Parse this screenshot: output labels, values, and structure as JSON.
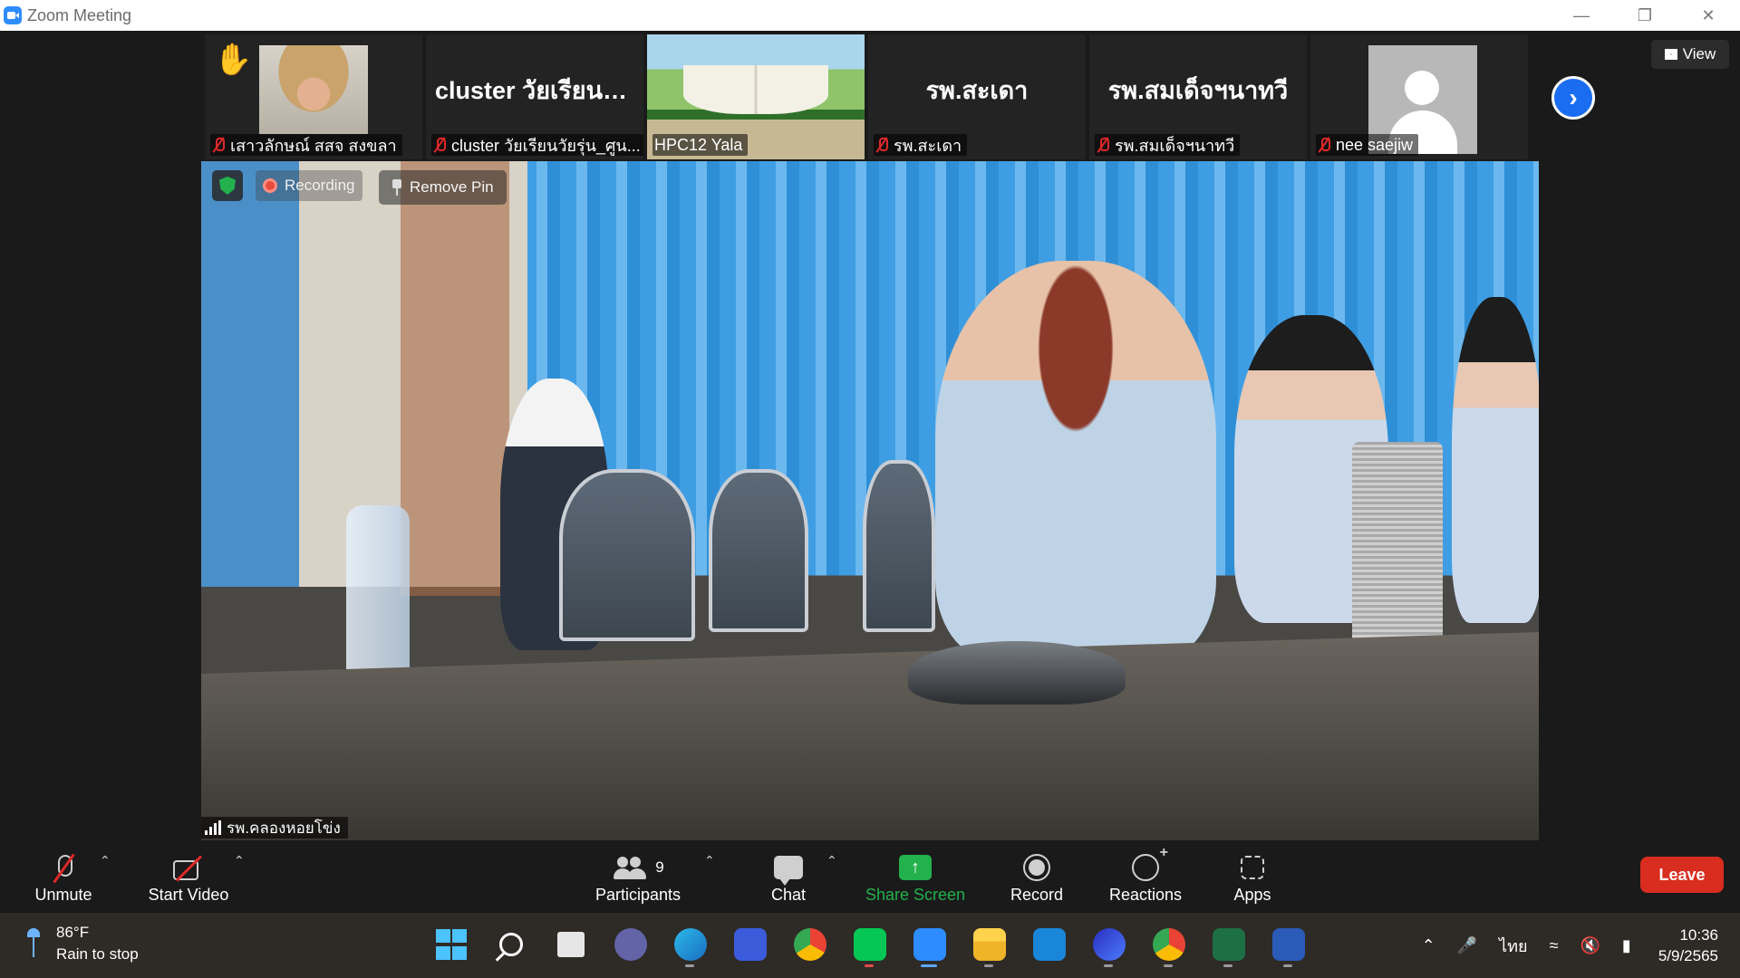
{
  "window": {
    "title": "Zoom Meeting"
  },
  "gallery": {
    "tiles": [
      {
        "type": "photo",
        "name": "เสาวลักษณ์ สสจ สงขลา",
        "hand_raised": true
      },
      {
        "type": "text",
        "display": "cluster วัยเรียนวั...",
        "name": "cluster วัยเรียนวัยรุ่น_ศูน..."
      },
      {
        "type": "photo",
        "name": "HPC12 Yala",
        "muted": false
      },
      {
        "type": "text",
        "display": "รพ.สะเดา",
        "name": "รพ.สะเดา"
      },
      {
        "type": "text",
        "display": "รพ.สมเด็จฯนาทวี",
        "name": "รพ.สมเด็จฯนาทวี"
      },
      {
        "type": "avatar",
        "name": "nee saejiw"
      }
    ],
    "view_label": "View"
  },
  "main_video": {
    "recording_label": "Recording",
    "remove_pin_label": "Remove Pin",
    "speaker_name": "รพ.คลองหอยโข่ง"
  },
  "toolbar": {
    "unmute": "Unmute",
    "start_video": "Start Video",
    "participants": "Participants",
    "participants_count": "9",
    "chat": "Chat",
    "share_screen": "Share Screen",
    "record": "Record",
    "reactions": "Reactions",
    "apps": "Apps",
    "leave": "Leave",
    "accent_share": "#22b14c",
    "accent_leave": "#d92d20"
  },
  "taskbar": {
    "weather_temp": "86°F",
    "weather_desc": "Rain to stop",
    "language": "ไทย",
    "time": "10:36",
    "date": "5/9/2565",
    "apps": [
      "windows-start",
      "search",
      "task-view",
      "teams-chat",
      "edge",
      "vscode",
      "chrome",
      "line",
      "zoom",
      "file-explorer",
      "mail",
      "browser",
      "chrome-profile",
      "excel",
      "word"
    ]
  }
}
